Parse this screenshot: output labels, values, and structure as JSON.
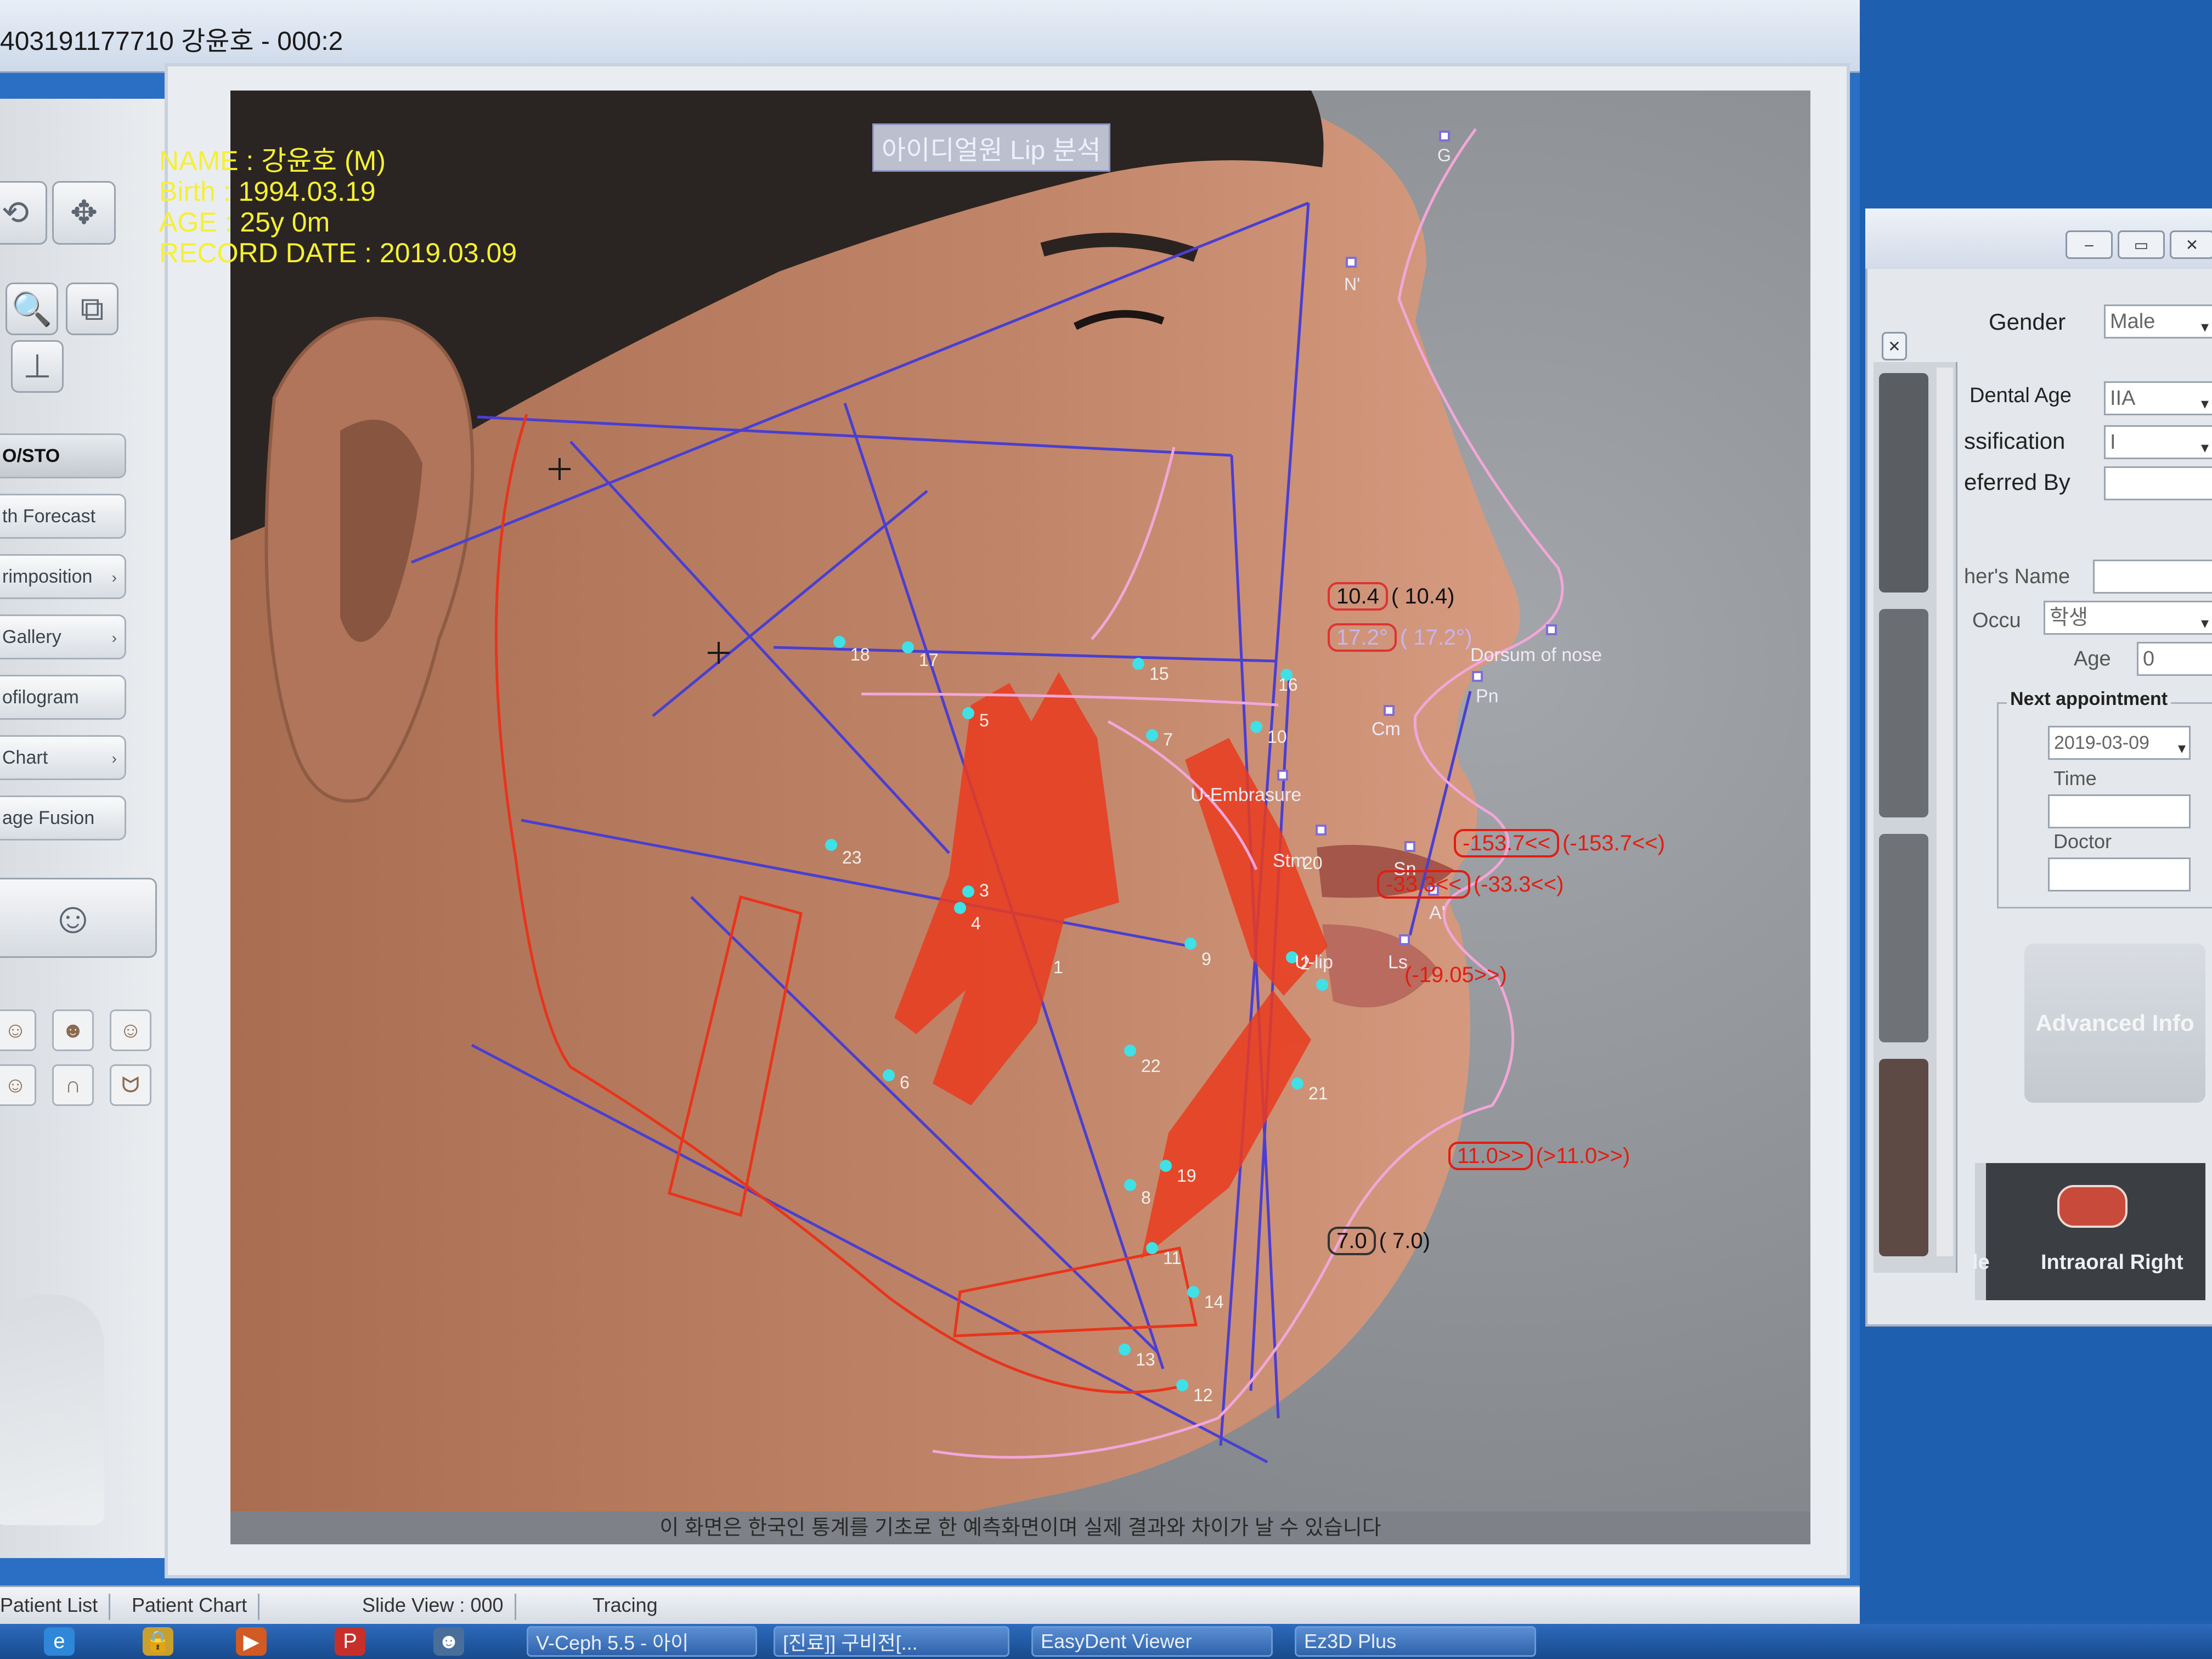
{
  "window": {
    "title": "403191177710 강윤호 - 000:2"
  },
  "left_panel": {
    "menu_items": [
      "O/STO",
      "th Forecast",
      "rimposition",
      "Gallery",
      "ofilogram",
      "Chart",
      "age Fusion"
    ]
  },
  "patient_info": {
    "name_line": "NAME : 강윤호 (M)",
    "birth_line": "Birth  : 1994.03.19",
    "age_line": "AGE  : 25y 0m",
    "record_line": "RECORD DATE : 2019.03.09"
  },
  "overlay": {
    "formula_title": "아이디얼원 Lip 분석",
    "landmark_labels": {
      "g": "G",
      "n_soft": "N'",
      "dorsum": "Dorsum of nose",
      "pn": "Pn",
      "cm": "Cm",
      "sn": "Sn",
      "a_soft": "A'",
      "u_embrasure": "U-Embrasure",
      "stm": "Stm",
      "ls": "Ls",
      "u_lip": "U-lip"
    },
    "point_numbers": [
      "1",
      "2",
      "3",
      "4",
      "5",
      "6",
      "7",
      "8",
      "9",
      "10",
      "11",
      "12",
      "13",
      "14",
      "15",
      "16",
      "17",
      "18",
      "19",
      "20",
      "21",
      "22",
      "23"
    ],
    "measurements": {
      "m1_box": "10.4",
      "m1_val": "( 10.4)",
      "m2_box": "17.2°",
      "m2_val": "( 17.2°)",
      "m3_box": "-153.7<<",
      "m3_val": "(-153.7<<)",
      "m4_box": "-33.3<<",
      "m4_val": "(-33.3<<)",
      "m5_val": "(-19.05>>)",
      "m6_box": "11.0>>",
      "m6_val": "(>11.0>>)",
      "m7_box": "7.0",
      "m7_val": "( 7.0)"
    },
    "disclaimer": "이 화면은 한국인 통계를 기초로 한 예측화면이며 실제 결과와 차이가 날 수 있습니다"
  },
  "right_dialog": {
    "gender_label": "Gender",
    "gender_value": "Male",
    "dental_age_label": "Dental Age",
    "dental_age_value": "IIA",
    "classification_label": "ssification",
    "classification_value": "I",
    "referred_label": "eferred By",
    "teacher_label": "her's Name",
    "occu_label": "Occu",
    "occu_value": "학생",
    "age_label": "Age",
    "age_value": "0",
    "next_appointment_label": "Next appointment",
    "next_appointment_value": "2019-03-09",
    "time_label": "Time",
    "doctor_label": "Doctor",
    "advanced_info_label": "Advanced Info",
    "intraoral_label": "Intraoral Right",
    "side_label": "le"
  },
  "status_bar": {
    "patient_list": "Patient List",
    "patient_chart": "Patient Chart",
    "slide_view": "Slide View : 000",
    "tracing": "Tracing"
  },
  "taskbar": {
    "items": [
      "V-Ceph 5.5 - 아이",
      "[진료]] 구비전[...",
      "EasyDent Viewer",
      "Ez3D Plus"
    ]
  },
  "colors": {
    "window_blue": "#2a6fc4",
    "info_text": "#f6f032",
    "trace_blue": "#4a3fd1",
    "trace_red": "#e8341c",
    "soft_tissue_pink": "#f2a6d8",
    "landmark_cyan": "#3fe0e6"
  }
}
